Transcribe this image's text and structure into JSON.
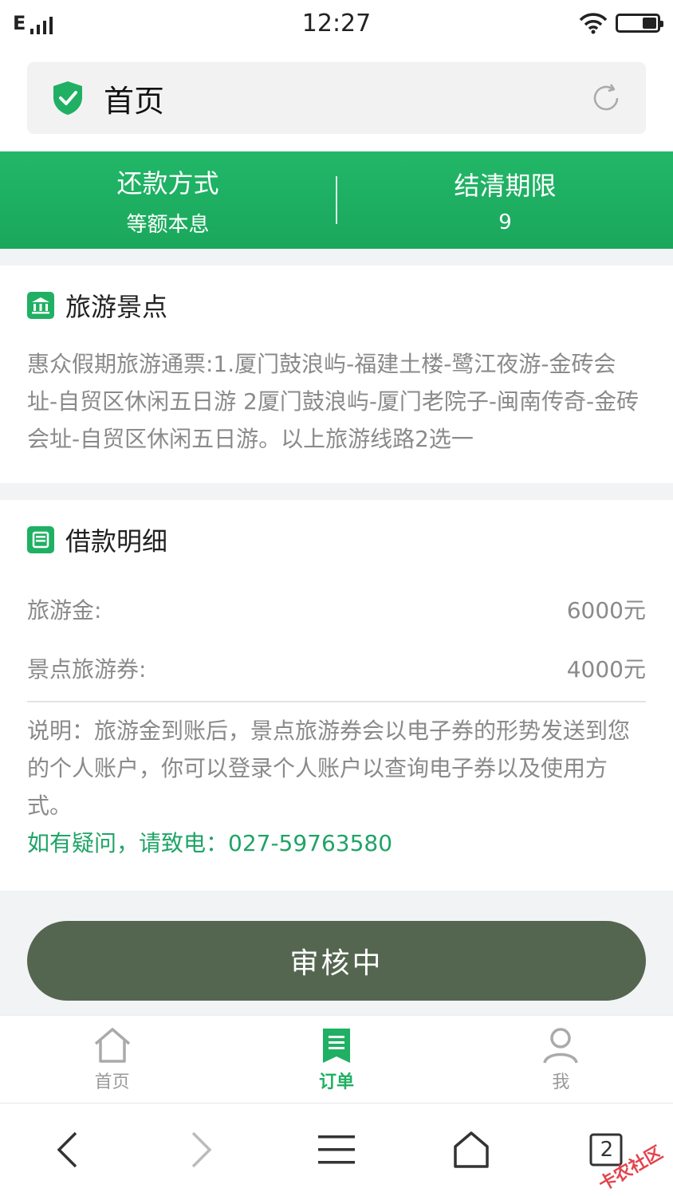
{
  "status_bar": {
    "network": "E",
    "time": "12:27"
  },
  "address_bar": {
    "title": "首页"
  },
  "banner": {
    "repayment": {
      "label": "还款方式",
      "value": "等额本息"
    },
    "term": {
      "label": "结清期限",
      "value": "9"
    }
  },
  "attraction": {
    "title": "旅游景点",
    "description": "惠众假期旅游通票:1.厦门鼓浪屿-福建土楼-鹭江夜游-金砖会址-自贸区休闲五日游 2厦门鼓浪屿-厦门老院子-闽南传奇-金砖会址-自贸区休闲五日游。以上旅游线路2选一"
  },
  "loan": {
    "title": "借款明细",
    "rows": [
      {
        "label": "旅游金:",
        "value": "6000元"
      },
      {
        "label": "景点旅游券:",
        "value": "4000元"
      }
    ],
    "note": "说明：旅游金到账后，景点旅游券会以电子券的形势发送到您的个人账户，你可以登录个人账户以查询电子券以及使用方式。",
    "contact": "如有疑问，请致电：027-59763580"
  },
  "status_button": {
    "label": "审核中"
  },
  "tabbar": {
    "home": "首页",
    "orders": "订单",
    "me": "我"
  },
  "browser": {
    "tab_count": "2"
  },
  "watermark": "卡农社区",
  "colors": {
    "primary_green": "#1fb063",
    "button_bg": "#556650",
    "contact_green": "#1fa466"
  }
}
